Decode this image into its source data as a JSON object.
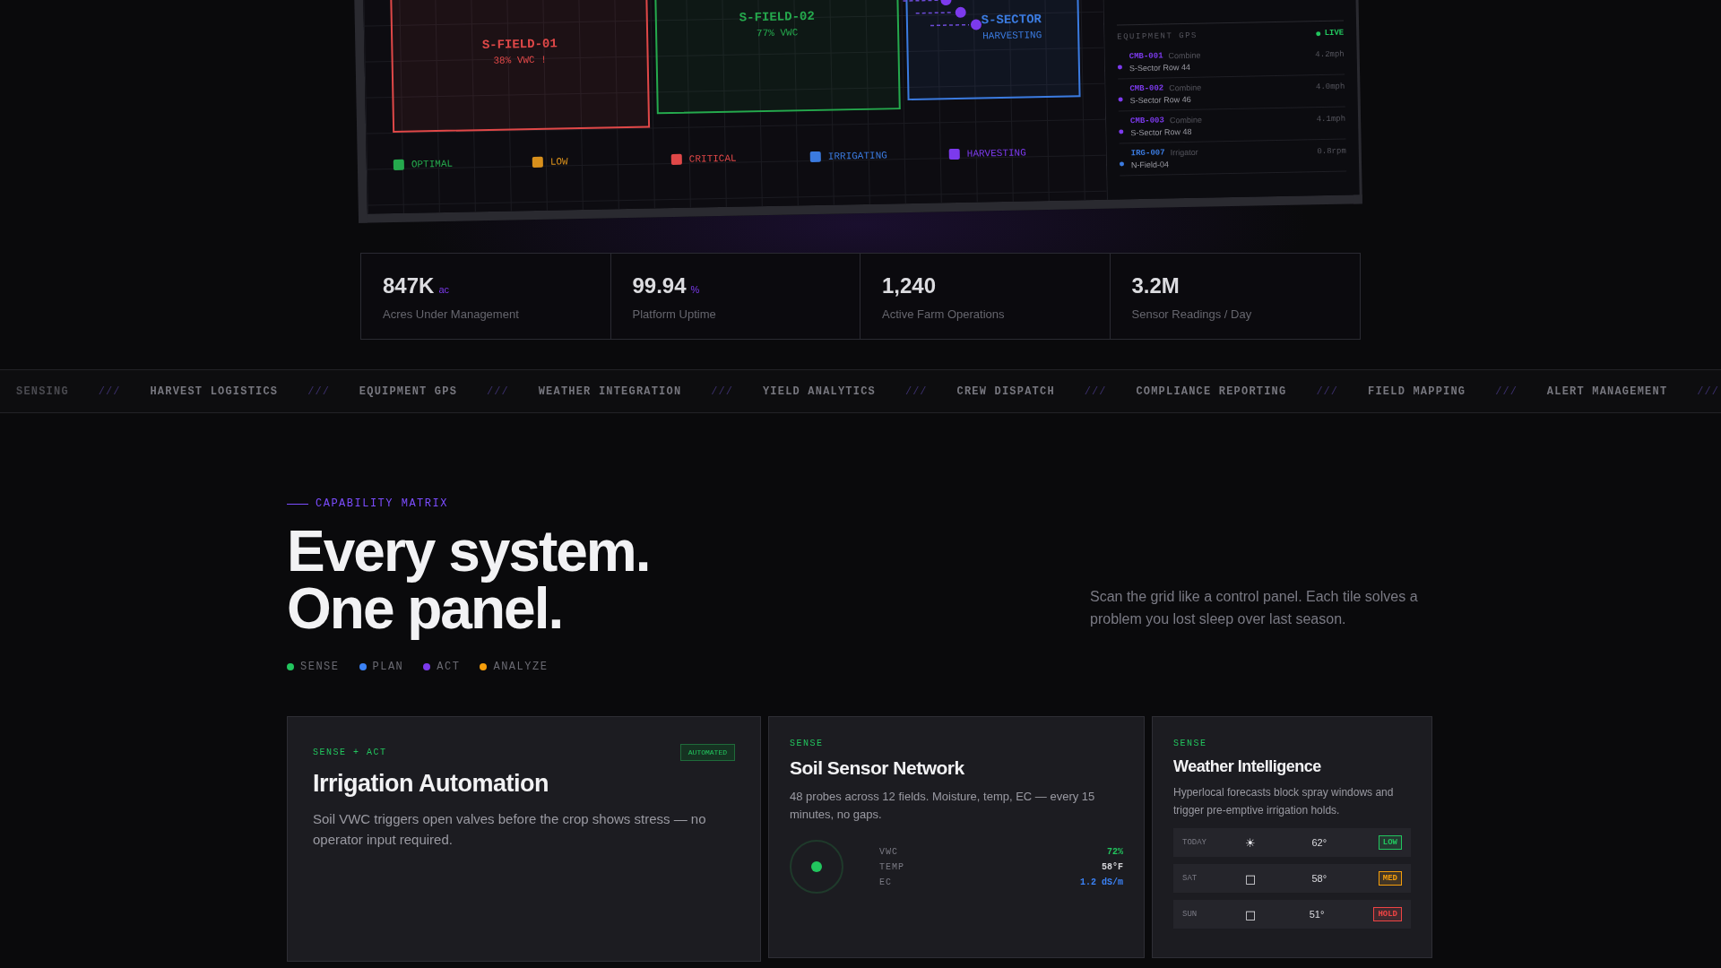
{
  "dashboard": {
    "fields": [
      {
        "name": "S-FIELD-01",
        "reading": "38% VWC !",
        "color": "#e04848"
      },
      {
        "name": "S-FIELD-02",
        "reading": "77% VWC",
        "color": "#25a94d"
      },
      {
        "name": "S-SECTOR",
        "reading": "HARVESTING",
        "color": "#3b7be0"
      }
    ],
    "legend": [
      {
        "label": "OPTIMAL",
        "color": "#25a94d"
      },
      {
        "label": "LOW",
        "color": "#d8901c"
      },
      {
        "label": "CRITICAL",
        "color": "#e04848"
      },
      {
        "label": "IRRIGATING",
        "color": "#3b7be0"
      },
      {
        "label": "HARVESTING",
        "color": "#7c3aed"
      }
    ],
    "equipment": {
      "title": "EQUIPMENT GPS",
      "live": "LIVE",
      "items": [
        {
          "id": "CMB-001",
          "type": "Combine",
          "location": "S-Sector Row 44",
          "speed": "4.2mph",
          "color": "#7c3aed"
        },
        {
          "id": "CMB-002",
          "type": "Combine",
          "location": "S-Sector Row 46",
          "speed": "4.0mph",
          "color": "#7c3aed"
        },
        {
          "id": "CMB-003",
          "type": "Combine",
          "location": "S-Sector Row 48",
          "speed": "4.1mph",
          "color": "#7c3aed"
        },
        {
          "id": "IRG-007",
          "type": "Irrigator",
          "location": "N-Field-04",
          "speed": "0.8rpm",
          "color": "#3b7be0"
        }
      ]
    }
  },
  "stats": [
    {
      "value": "847K",
      "unit": "ac",
      "label": "Acres Under Management"
    },
    {
      "value": "99.94",
      "unit": "%",
      "label": "Platform Uptime"
    },
    {
      "value": "1,240",
      "label": "Active Farm Operations"
    },
    {
      "value": "3.2M",
      "label": "Sensor Readings / Day"
    }
  ],
  "ticker": {
    "items": [
      "SENSING",
      "HARVEST LOGISTICS",
      "EQUIPMENT GPS",
      "WEATHER INTEGRATION",
      "YIELD ANALYTICS",
      "CREW DISPATCH",
      "COMPLIANCE REPORTING",
      "FIELD MAPPING",
      "ALERT MANAGEMENT"
    ],
    "separator": "///"
  },
  "capability": {
    "eyebrow": "CAPABILITY MATRIX",
    "heading": [
      "Every system.",
      "One panel."
    ],
    "description": "Scan the grid like a control panel. Each tile solves a problem you lost sleep over last season.",
    "legend": [
      {
        "label": "SENSE",
        "color": "#22c55e"
      },
      {
        "label": "PLAN",
        "color": "#3b82f6"
      },
      {
        "label": "ACT",
        "color": "#7c3aed"
      },
      {
        "label": "ANALYZE",
        "color": "#f59e0b"
      }
    ]
  },
  "cards": [
    {
      "kind": "irrigation",
      "tag": "SENSE + ACT",
      "badge": "AUTOMATED",
      "title": "Irrigation Automation",
      "text": "Soil VWC triggers open valves before the crop shows stress — no operator input required."
    },
    {
      "kind": "sensor",
      "tag": "SENSE",
      "title": "Soil Sensor Network",
      "text": "48 probes across 12 fields. Moisture, temp, EC — every 15 minutes, no gaps.",
      "readings": [
        {
          "label": "VWC",
          "value": "72%",
          "color": "#22c55e"
        },
        {
          "label": "TEMP",
          "value": "58°F",
          "color": "#d4d4d8"
        },
        {
          "label": "EC",
          "value": "1.2 dS/m",
          "color": "#3b82f6"
        }
      ]
    },
    {
      "kind": "weather",
      "tag": "SENSE",
      "title": "Weather Intelligence",
      "text": "Hyperlocal forecasts block spray windows and trigger pre-emptive irrigation holds.",
      "forecast": [
        {
          "day": "TODAY",
          "icon": "☀",
          "temp": "62°",
          "risk": "LOW",
          "color": "#22c55e"
        },
        {
          "day": "SAT",
          "icon": "□",
          "temp": "58°",
          "risk": "MED",
          "color": "#f59e0b"
        },
        {
          "day": "SUN",
          "icon": "□",
          "temp": "51°",
          "risk": "HOLD",
          "color": "#ef4444"
        }
      ]
    }
  ]
}
